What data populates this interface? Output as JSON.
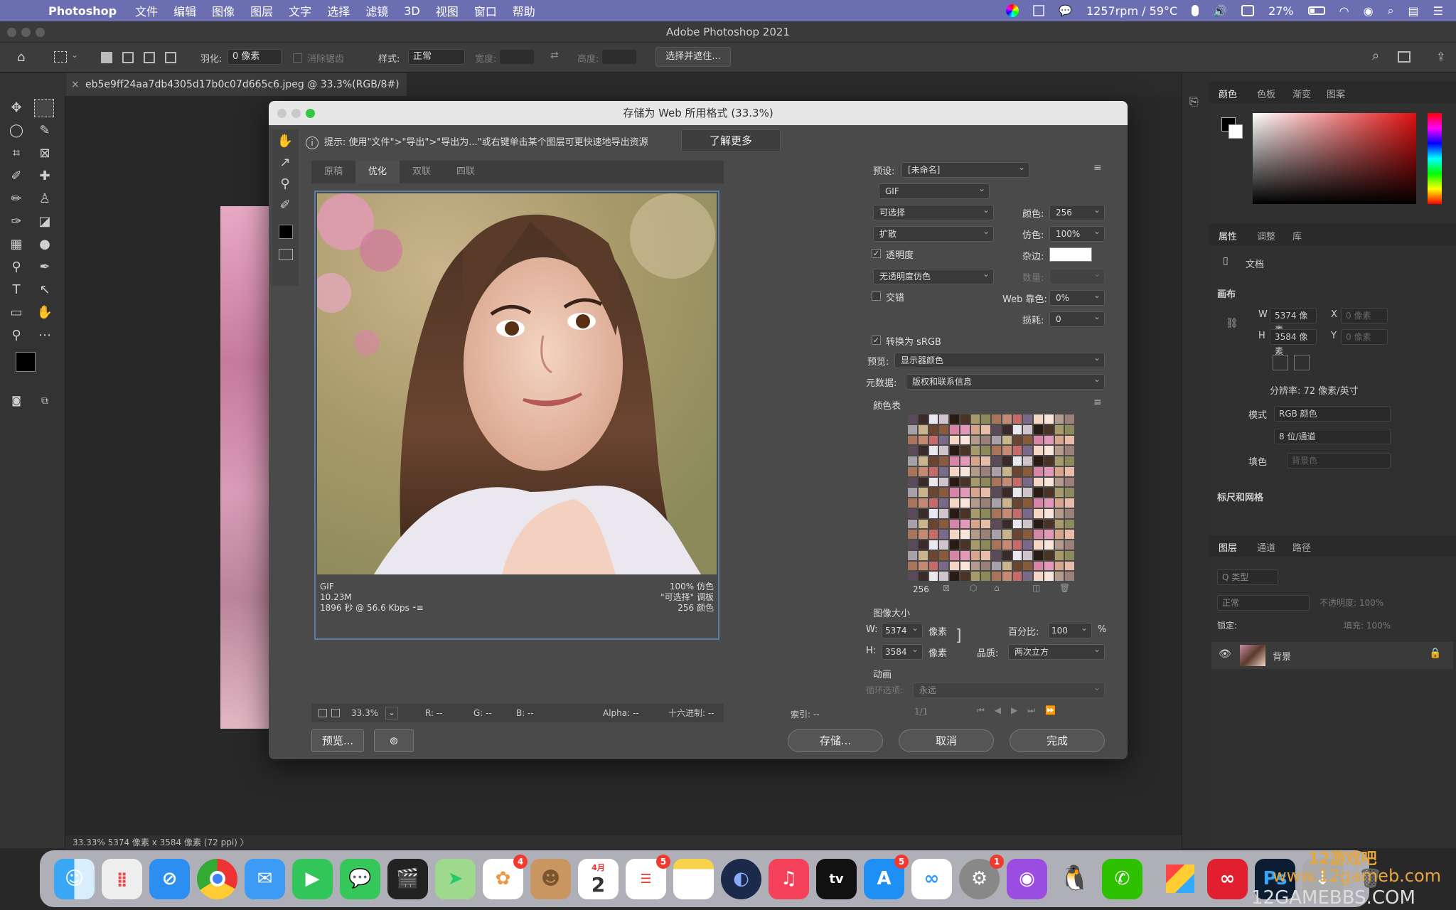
{
  "menubar": {
    "app": "Photoshop",
    "items": [
      "文件",
      "编辑",
      "图像",
      "图层",
      "文字",
      "选择",
      "滤镜",
      "3D",
      "视图",
      "窗口",
      "帮助"
    ],
    "status": "1257rpm / 59°C",
    "battery": "27%"
  },
  "window": {
    "title": "Adobe Photoshop 2021"
  },
  "options": {
    "feather_label": "羽化:",
    "feather_value": "0 像素",
    "antialias": "消除锯齿",
    "style_label": "样式:",
    "style_value": "正常",
    "width_label": "宽度:",
    "height_label": "高度:",
    "select_mask": "选择并遮住..."
  },
  "doc_tab": "eb5e9ff24aa7db4305d17b0c07d665c6.jpeg @ 33.3%(RGB/8#)",
  "status_bar": "33.33%    5374 像素 x 3584 像素 (72 ppi)  〉",
  "dialog": {
    "title": "存储为 Web 所用格式 (33.3%)",
    "hint": "提示: 使用\"文件\">\"导出\">\"导出为...\"或右键单击某个图层可更快速地导出资源",
    "learn_more": "了解更多",
    "tabs": [
      "原稿",
      "优化",
      "双联",
      "四联"
    ],
    "preview_info_left": [
      "GIF",
      "10.23M",
      "1896 秒 @ 56.6 Kbps  ⁃≡"
    ],
    "preview_info_right": [
      "100% 仿色",
      "\"可选择\" 调板",
      "256 颜色"
    ],
    "zoom": "33.3%",
    "readouts": [
      "R: --",
      "G: --",
      "B: --",
      "Alpha: --",
      "十六进制: --",
      "索引: --"
    ],
    "preset_label": "预设:",
    "preset_value": "[未命名]",
    "format": "GIF",
    "reduction": "可选择",
    "dither_algo": "扩散",
    "colors_label": "颜色:",
    "colors_value": "256",
    "dither_label": "仿色:",
    "dither_value": "100%",
    "transparency": "透明度",
    "matte_label": "杂边:",
    "no_trans_dither": "无透明度仿色",
    "amount_label": "数量:",
    "interlaced": "交错",
    "web_snap_label": "Web 靠色:",
    "web_snap_value": "0%",
    "lossy_label": "损耗:",
    "lossy_value": "0",
    "convert_srgb": "转换为 sRGB",
    "preview_label": "预览:",
    "preview_value": "显示器颜色",
    "metadata_label": "元数据:",
    "metadata_value": "版权和联系信息",
    "color_table_label": "颜色表",
    "color_count": "256",
    "image_size_label": "图像大小",
    "w_label": "W:",
    "w_value": "5374",
    "h_label": "H:",
    "h_value": "3584",
    "px": "像素",
    "percent_label": "百分比:",
    "percent_value": "100",
    "percent_unit": "%",
    "quality_label": "品质:",
    "quality_value": "两次立方",
    "animation_label": "动画",
    "loop_label": "循环选项:",
    "loop_value": "永远",
    "frame": "1/1",
    "preview_btn": "预览...",
    "save_btn": "存储...",
    "cancel_btn": "取消",
    "done_btn": "完成"
  },
  "panels": {
    "color_tabs": [
      "颜色",
      "色板",
      "渐变",
      "图案"
    ],
    "props_tabs": [
      "属性",
      "调整",
      "库"
    ],
    "doc_label": "文档",
    "canvas_label": "画布",
    "w": "5374 像素",
    "h": "3584 像素",
    "x_label": "X",
    "y_label": "Y",
    "x_ph": "0 像素",
    "resolution": "分辨率: 72 像素/英寸",
    "mode_label": "模式",
    "mode_value": "RGB 颜色",
    "depth_value": "8 位/通道",
    "fill_label": "填色",
    "fill_value": "背景色",
    "ruler_label": "标尺和网格",
    "layer_tabs": [
      "图层",
      "通道",
      "路径"
    ],
    "layer_kind": "Q 类型",
    "blend": "正常",
    "opacity": "不透明度: 100%",
    "lock": "锁定:",
    "fill": "填充: 100%",
    "layer_name": "背景"
  },
  "dock": {
    "badges": {
      "photos": "4",
      "appstore": "5",
      "settings": "1",
      "reminders": "5"
    },
    "calendar_month": "4月",
    "calendar_day": "2"
  },
  "watermark": {
    "line1": "12游戏吧",
    "line2": "www.12gameb.com",
    "line3": "12GAMEBBS.COM"
  }
}
